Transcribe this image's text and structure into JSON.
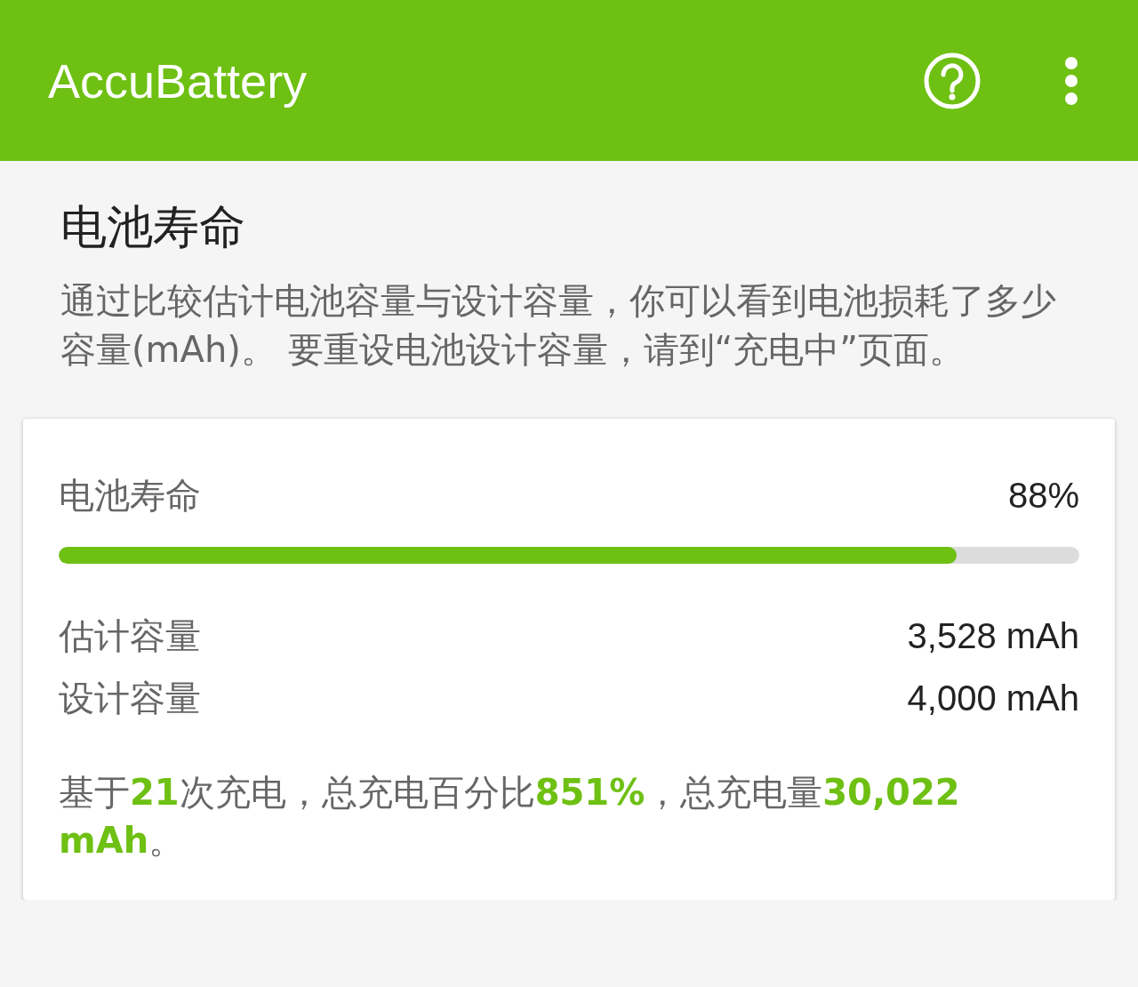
{
  "app_bar": {
    "title": "AccuBattery"
  },
  "section": {
    "title": "电池寿命",
    "description": "通过比较估计电池容量与设计容量，你可以看到电池损耗了多少容量(mAh)。 要重设电池设计容量，请到“充电中”页面。"
  },
  "card": {
    "health_label": "电池寿命",
    "health_value": "88%",
    "level": 0.88,
    "rows": [
      {
        "label": "估计容量",
        "value": "3,528 mAh"
      },
      {
        "label": "设计容量",
        "value": "4,000 mAh"
      }
    ],
    "summary": "基于**21**次充电，总充电百分比**851%**，总充电量**30,022 mAh**。"
  }
}
